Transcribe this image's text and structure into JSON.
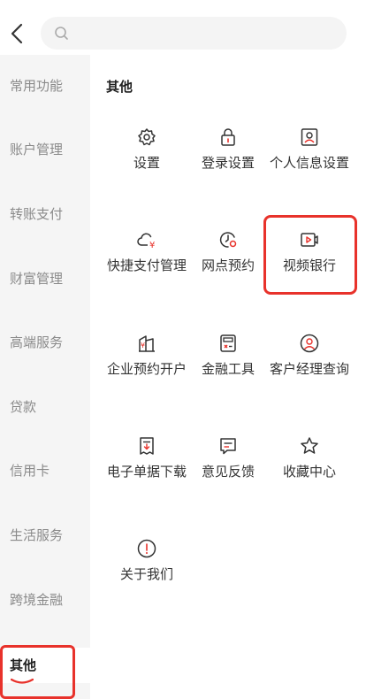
{
  "search": {
    "placeholder": ""
  },
  "sidebar": {
    "items": [
      {
        "label": "常用功能"
      },
      {
        "label": "账户管理"
      },
      {
        "label": "转账支付"
      },
      {
        "label": "财富管理"
      },
      {
        "label": "高端服务"
      },
      {
        "label": "贷款"
      },
      {
        "label": "信用卡"
      },
      {
        "label": "生活服务"
      },
      {
        "label": "跨境金融"
      },
      {
        "label": "其他"
      }
    ]
  },
  "main": {
    "section_title": "其他",
    "items": [
      {
        "label": "设置",
        "icon": "gear-icon"
      },
      {
        "label": "登录设置",
        "icon": "lock-icon"
      },
      {
        "label": "个人信息设置",
        "icon": "id-card-icon"
      },
      {
        "label": "快捷支付管理",
        "icon": "cloud-yen-icon"
      },
      {
        "label": "网点预约",
        "icon": "clock-pin-icon"
      },
      {
        "label": "视频银行",
        "icon": "video-icon"
      },
      {
        "label": "企业预约开户",
        "icon": "building-yen-icon"
      },
      {
        "label": "金融工具",
        "icon": "calculator-icon"
      },
      {
        "label": "客户经理查询",
        "icon": "advisor-icon"
      },
      {
        "label": "电子单据下载",
        "icon": "receipt-download-icon"
      },
      {
        "label": "意见反馈",
        "icon": "feedback-icon"
      },
      {
        "label": "收藏中心",
        "icon": "star-icon"
      },
      {
        "label": "关于我们",
        "icon": "info-icon"
      }
    ]
  },
  "colors": {
    "accent": "#e8322b",
    "sidebar_bg": "#f5f5f5",
    "search_bg": "#f4f4f4"
  }
}
